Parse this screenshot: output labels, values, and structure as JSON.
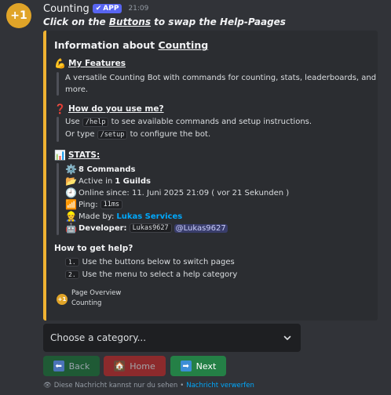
{
  "message": {
    "avatar_text": "+1",
    "username": "Counting",
    "badge": "APP",
    "timestamp": "21:09",
    "subtitle_pre": "Click on the ",
    "subtitle_link": "Buttons",
    "subtitle_post": " to swap the Help-Paages"
  },
  "embed": {
    "accent_color": "#f0b232",
    "title_pre": "Information about ",
    "title_name": "Counting",
    "features": {
      "heading": "My Features",
      "text1": "A versatile Counting Bot with commands for counting, stats, leaderboards, and",
      "text2": "more."
    },
    "usage": {
      "heading": "How do you use me?",
      "line1_pre": "Use ",
      "line1_code": "/help",
      "line1_post": " to see available commands and setup instructions.",
      "line2_pre": "Or type ",
      "line2_code": "/setup",
      "line2_post": " to configure the bot."
    },
    "stats": {
      "heading": "STATS:",
      "commands": "8 Commands",
      "active_pre": "Active in ",
      "active_val": "1 Guilds",
      "online": "Online since:  11. Juni 2025 21:09 ( vor 21 Sekunden )",
      "ping_label": "Ping: ",
      "ping_val": "11ms",
      "made_by_label": "Made by: ",
      "made_by_val": "Lukas Services",
      "developer_label": "Developer: ",
      "developer_code": "Lukas9627",
      "developer_mention": "@Lukas9627"
    },
    "help": {
      "heading": "How to get help?",
      "step1_num": "1.",
      "step1": "Use the buttons below to switch pages",
      "step2_num": "2.",
      "step2": "Use the menu to select a help category"
    },
    "footer": {
      "line1": "Page Overview",
      "line2": "Counting"
    }
  },
  "select": {
    "placeholder": "Choose a category..."
  },
  "buttons": {
    "back": "Back",
    "home": "Home",
    "next": "Next"
  },
  "ephemeral": {
    "text": "Diese Nachricht kannst nur du sehen",
    "separator": "•",
    "dismiss": "Nachricht verwerfen"
  }
}
